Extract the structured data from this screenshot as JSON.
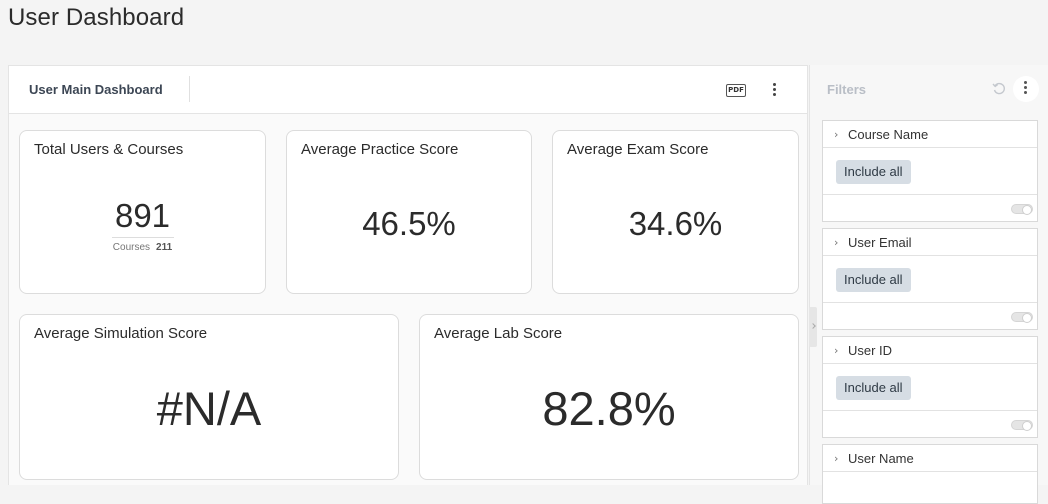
{
  "page": {
    "title": "User Dashboard"
  },
  "dashboard": {
    "title": "User Main Dashboard",
    "pdf_label": "PDF",
    "cards": {
      "total": {
        "title": "Total Users & Courses",
        "value": "891",
        "sub_label": "Courses",
        "sub_value": "211"
      },
      "practice": {
        "title": "Average Practice Score",
        "value": "46.5%"
      },
      "exam": {
        "title": "Average Exam Score",
        "value": "34.6%"
      },
      "simulation": {
        "title": "Average Simulation Score",
        "value": "#N/A"
      },
      "lab": {
        "title": "Average Lab Score",
        "value": "82.8%"
      }
    }
  },
  "filters": {
    "title": "Filters",
    "items": [
      {
        "label": "Course Name",
        "chip": "Include all"
      },
      {
        "label": "User Email",
        "chip": "Include all"
      },
      {
        "label": "User ID",
        "chip": "Include all"
      },
      {
        "label": "User Name"
      }
    ]
  },
  "icons": {
    "pdf": "pdf-export-icon",
    "menu": "kebab-menu-icon",
    "reset": "reset-icon",
    "expand": "chevron-right-icon",
    "toggle": "toggle-switch"
  }
}
